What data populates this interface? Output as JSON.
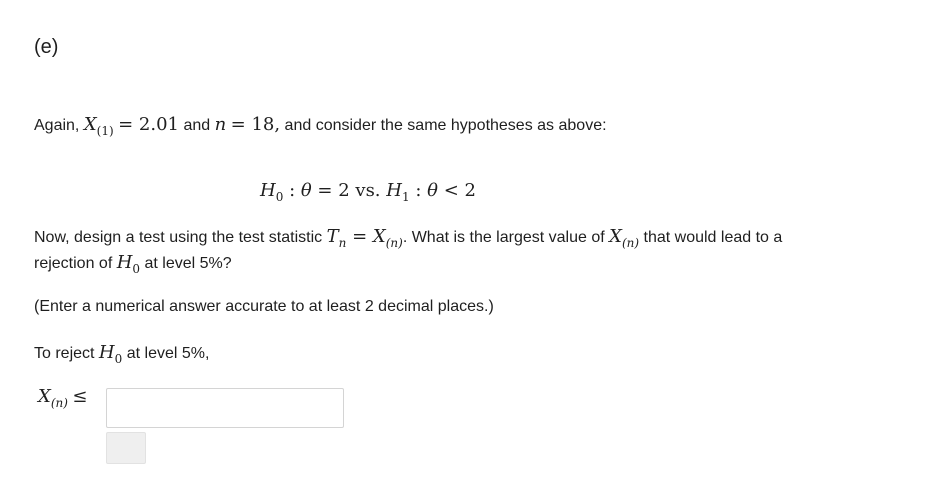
{
  "part_label": "(e)",
  "intro": {
    "text_1": "Again,",
    "x1_sym": "X",
    "x1_sub": "(1)",
    "eq_val": "= 2.01",
    "and": "and",
    "n_sym": "n",
    "n_val": "= 18,",
    "text_2": "and consider the same hypotheses as above:"
  },
  "hypotheses": {
    "h0": "H",
    "h0_sub": "0",
    "colon1": " : ",
    "theta1": "θ",
    "h0_rel": " = 2 vs. ",
    "h1": "H",
    "h1_sub": "1",
    "colon2": " : ",
    "theta2": "θ",
    "h1_rel": " < 2"
  },
  "question": {
    "text_1": "Now, design a test using the test statistic",
    "t_sym": "T",
    "t_sub": "n",
    "eq": " = ",
    "x_sym": "X",
    "x_sub": "(n)",
    "text_2": ". What is the largest value of",
    "x2_sym": "X",
    "x2_sub": "(n)",
    "text_3": "that would lead to a",
    "line2_text_1": "rejection of",
    "h_sym": "H",
    "h_sub": "0",
    "line2_text_2": "at level 5%?"
  },
  "instruction": "(Enter a numerical answer accurate to at least 2 decimal places.)",
  "reject_line": {
    "text_1": "To reject",
    "h_sym": "H",
    "h_sub": "0",
    "text_2": "at level 5%,"
  },
  "answer": {
    "label_sym": "X",
    "label_sub": "(n)",
    "label_rel": "≤",
    "value": "",
    "placeholder": ""
  }
}
